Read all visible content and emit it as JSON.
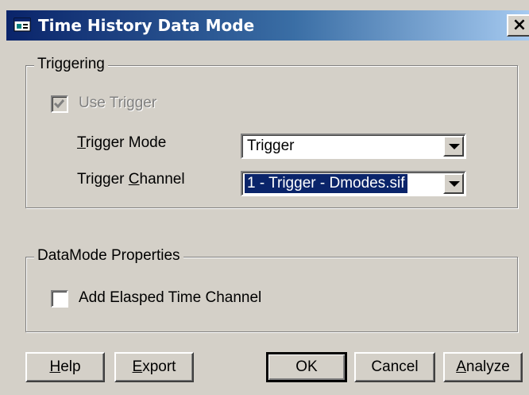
{
  "window": {
    "title": "Time History Data Mode",
    "close_glyph": "×"
  },
  "triggering": {
    "legend": "Triggering",
    "use_trigger_label": "Use Trigger",
    "use_trigger_checked": true,
    "mode_label_mnemonic": "T",
    "mode_label_rest": "rigger Mode",
    "mode_value": "Trigger",
    "channel_label_pre": "Trigger ",
    "channel_label_mnemonic": "C",
    "channel_label_post": "hannel",
    "channel_value": "1 - Trigger - Dmodes.sif"
  },
  "datamode": {
    "legend": "DataMode Properties",
    "elapsed_label": "Add Elasped Time Channel",
    "elapsed_checked": false
  },
  "buttons": {
    "help_mnemonic": "H",
    "help_rest": "elp",
    "export_mnemonic": "E",
    "export_rest": "xport",
    "ok": "OK",
    "cancel": "Cancel",
    "analyze_mnemonic": "A",
    "analyze_rest": "nalyze"
  },
  "icons": {
    "app": "window-app-icon",
    "dropdown": "chevron-down-icon",
    "check": "checkmark-icon"
  }
}
